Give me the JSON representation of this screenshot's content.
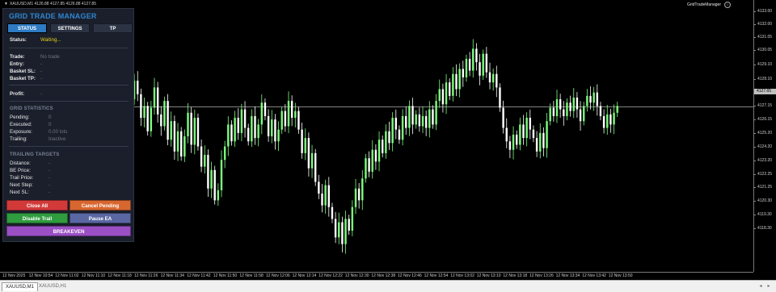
{
  "chart": {
    "symbol_info": "XAUUSD,M1  4126.88 4127.85 4126.88 4127.85",
    "ea_name": "GridTradeManager",
    "price_ticks": [
      "4133.00",
      "4132.00",
      "4131.05",
      "4130.05",
      "4129.10",
      "4128.10",
      "4127.65",
      "4127.15",
      "4126.15",
      "4125.20",
      "4124.20",
      "4123.20",
      "4122.25",
      "4121.25",
      "4120.30",
      "4119.30",
      "4118.30"
    ],
    "current_price": "4127.65",
    "time_ticks": [
      "12 Nov 2025",
      "12 Nov 10:54",
      "12 Nov 11:02",
      "12 Nov 11:10",
      "12 Nov 11:18",
      "12 Nov 11:26",
      "12 Nov 11:34",
      "12 Nov 11:42",
      "12 Nov 11:50",
      "12 Nov 11:58",
      "12 Nov 12:06",
      "12 Nov 12:14",
      "12 Nov 12:22",
      "12 Nov 12:30",
      "12 Nov 12:38",
      "12 Nov 12:46",
      "12 Nov 12:54",
      "12 Nov 13:02",
      "12 Nov 13:10",
      "12 Nov 13:18",
      "12 Nov 13:26",
      "12 Nov 13:34",
      "12 Nov 13:42",
      "12 Nov 13:50"
    ],
    "colors": {
      "bull": "#7dff7d",
      "bear": "#ffffff",
      "bid_line": "#b0b0b0"
    },
    "price_range": [
      4117.8,
      4133.6
    ],
    "closes": [
      4124.5,
      4126.2,
      4125.0,
      4123.4,
      4126.5,
      4127.9,
      4129.0,
      4128.2,
      4126.8,
      4127.5,
      4126.0,
      4127.4,
      4128.6,
      4127.0,
      4126.3,
      4127.8,
      4125.5,
      4126.6,
      4124.8,
      4126.0,
      4124.5,
      4125.7,
      4127.1,
      4125.2,
      4126.8,
      4125.1,
      4123.9,
      4124.6,
      4122.6,
      4123.7,
      4121.9,
      4122.5,
      4124.3,
      4125.1,
      4126.4,
      4125.4,
      4126.8,
      4125.9,
      4127.3,
      4126.2,
      4125.4,
      4126.9,
      4125.6,
      4126.4,
      4127.7,
      4126.9,
      4125.7,
      4126.7,
      4125.4,
      4126.1,
      4127.2,
      4126.3,
      4127.8,
      4126.8,
      4127.2,
      4126.1,
      4124.7,
      4125.6,
      4123.8,
      4124.7,
      4123.0,
      4122.3,
      4121.6,
      4122.8,
      4121.5,
      4120.8,
      4119.7,
      4120.6,
      4119.3,
      4120.8,
      4120.1,
      4121.5,
      4122.6,
      4121.9,
      4123.2,
      4124.4,
      4123.6,
      4124.9,
      4124.2,
      4125.5,
      4124.7,
      4126.0,
      4125.3,
      4126.8,
      4126.1,
      4125.5,
      4126.9,
      4126.2,
      4127.5,
      4126.4,
      4127.0,
      4126.3,
      4126.9,
      4126.2,
      4127.3,
      4126.4,
      4127.8,
      4128.5,
      4127.6,
      4128.9,
      4128.1,
      4129.4,
      4128.5,
      4129.7,
      4129.2,
      4130.3,
      4129.6,
      4130.9,
      4130.1,
      4129.3,
      4130.6,
      4129.5,
      4128.9,
      4129.4,
      4128.6,
      4127.4,
      4126.2,
      4125.4,
      4124.9,
      4125.8,
      4125.2,
      4126.4,
      4125.6,
      4126.8,
      4126.1,
      4125.6,
      4124.8,
      4125.9,
      4125.0,
      4126.6,
      4127.4,
      4126.9,
      4127.9,
      4127.3,
      4126.9,
      4127.7,
      4127.2,
      4128.0,
      4127.3,
      4126.6,
      4127.5,
      4128.1,
      4127.7,
      4128.3,
      4127.5,
      4126.9,
      4126.2,
      4127.0,
      4126.4,
      4127.1,
      4127.5
    ]
  },
  "panel": {
    "title": "GRID TRADE MANAGER",
    "tabs": [
      "STATUS",
      "SETTINGS",
      "TP"
    ],
    "status_label": "Status:",
    "status_value": "Waiting...",
    "trade_rows": [
      {
        "label": "Trade:",
        "value": "No trade"
      },
      {
        "label": "Entry:",
        "value": "-"
      },
      {
        "label": "Basket SL:",
        "value": "-"
      },
      {
        "label": "Basket TP:",
        "value": "-"
      }
    ],
    "profit_label": "Profit:",
    "profit_value": "-",
    "grid_title": "GRID STATISTICS",
    "grid_rows": [
      {
        "label": "Pending:",
        "value": "0"
      },
      {
        "label": "Executed:",
        "value": "0"
      },
      {
        "label": "Exposure:",
        "value": "0.00 lots"
      },
      {
        "label": "Trailing:",
        "value": "Inactive"
      }
    ],
    "trail_title": "TRAILING TARGETS",
    "trail_rows": [
      {
        "label": "Distance:",
        "value": "-"
      },
      {
        "label": "BE Price:",
        "value": "-"
      },
      {
        "label": "Trail Price:",
        "value": "-"
      },
      {
        "label": "Next Step:",
        "value": "-"
      },
      {
        "label": "Next SL:",
        "value": "-"
      }
    ],
    "buttons": {
      "close_all": "Close All",
      "cancel_pending": "Cancel Pending",
      "disable_trail": "Disable Trail",
      "pause_ea": "Pause EA",
      "breakeven": "BREAKEVEN"
    },
    "colors": {
      "title": "#2f86d1",
      "close_all": "#d23a3a",
      "cancel_pending": "#d8672f",
      "disable_trail": "#2f9c3f",
      "pause_ea": "#5a67a3",
      "breakeven": "#9b4fc4"
    }
  },
  "tabs_bar": {
    "tabs": [
      "XAUUSD,M1",
      "XAUUSD,H1"
    ]
  }
}
